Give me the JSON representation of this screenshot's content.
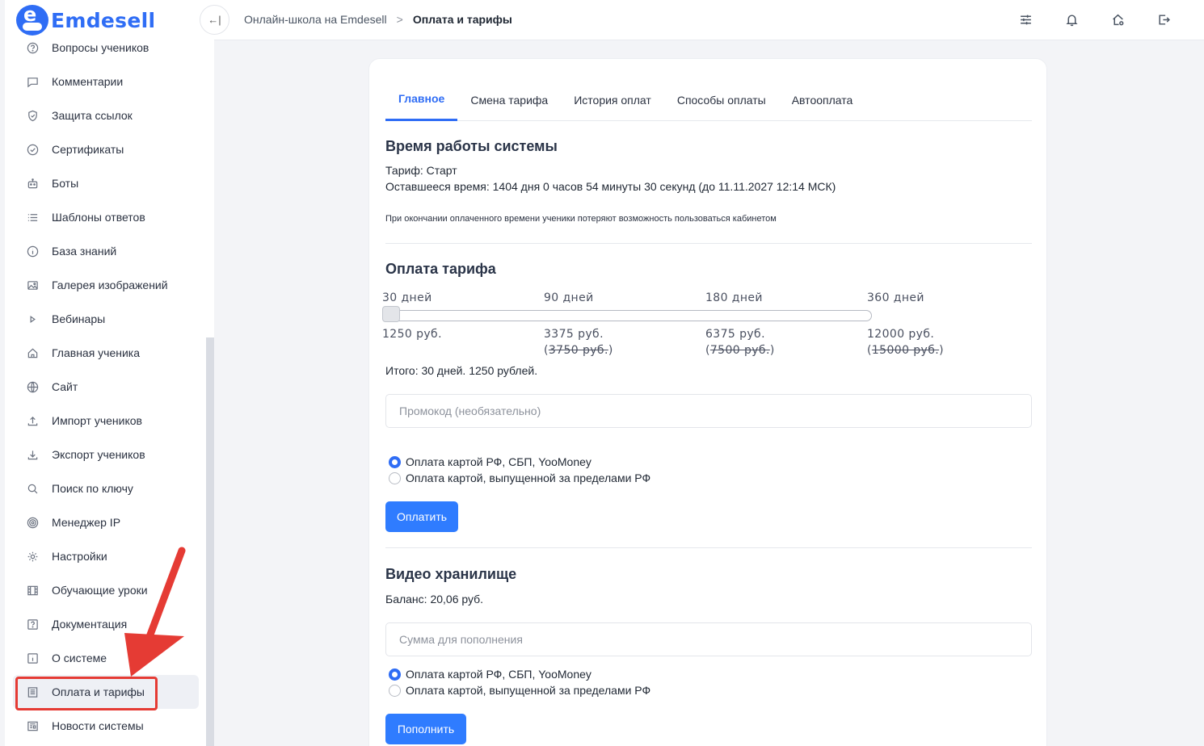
{
  "brand": {
    "name": "Emdesell"
  },
  "sidebar": {
    "items": [
      {
        "label": "Вопросы учеников",
        "icon": "question-circle-icon"
      },
      {
        "label": "Комментарии",
        "icon": "comment-icon"
      },
      {
        "label": "Защита ссылок",
        "icon": "shield-icon"
      },
      {
        "label": "Сертификаты",
        "icon": "check-circle-icon"
      },
      {
        "label": "Боты",
        "icon": "robot-icon"
      },
      {
        "label": "Шаблоны ответов",
        "icon": "list-icon"
      },
      {
        "label": "База знаний",
        "icon": "info-circle-icon"
      },
      {
        "label": "Галерея изображений",
        "icon": "image-icon"
      },
      {
        "label": "Вебинары",
        "icon": "play-icon"
      },
      {
        "label": "Главная ученика",
        "icon": "home-icon"
      },
      {
        "label": "Сайт",
        "icon": "globe-icon"
      },
      {
        "label": "Импорт учеников",
        "icon": "upload-icon"
      },
      {
        "label": "Экспорт учеников",
        "icon": "download-icon"
      },
      {
        "label": "Поиск по ключу",
        "icon": "search-icon"
      },
      {
        "label": "Менеджер IP",
        "icon": "target-icon"
      },
      {
        "label": "Настройки",
        "icon": "gear-icon"
      },
      {
        "label": "Обучающие уроки",
        "icon": "film-icon"
      },
      {
        "label": "Документация",
        "icon": "question-square-icon"
      },
      {
        "label": "О системе",
        "icon": "info-square-icon"
      },
      {
        "label": "Оплата и тарифы",
        "icon": "receipt-icon",
        "active": true
      },
      {
        "label": "Новости системы",
        "icon": "newspaper-icon"
      }
    ]
  },
  "topbar": {
    "breadcrumb_1": "Онлайн-школа на Emdesell",
    "breadcrumb_sep": ">",
    "breadcrumb_2": "Оплата и тарифы",
    "collapse_icon": "collapse-left-icon",
    "icons": [
      "sliders-icon",
      "bell-icon",
      "home-gear-icon",
      "logout-icon"
    ]
  },
  "tabs": [
    "Главное",
    "Смена тарифа",
    "История оплат",
    "Способы оплаты",
    "Автооплата"
  ],
  "system_time": {
    "title": "Время работы системы",
    "tariff": "Тариф: Старт",
    "remaining": "Оставшееся время: 1404 дня 0 часов 54 минуты 30 секунд (до 11.11.2027 12:14 МСК)",
    "note": "При окончании оплаченного времени ученики потеряют возможность пользоваться кабинетом"
  },
  "tariff_payment": {
    "title": "Оплата тарифа",
    "slider_value_index": 0,
    "tiers": [
      {
        "days": "30 дней",
        "price": "1250 руб.",
        "old_price": ""
      },
      {
        "days": "90 дней",
        "price": "3375 руб.",
        "old_price": "3750 руб."
      },
      {
        "days": "180 дней",
        "price": "6375 руб.",
        "old_price": "7500 руб."
      },
      {
        "days": "360 дней",
        "price": "12000 руб.",
        "old_price": "15000 руб."
      }
    ],
    "total": "Итого: 30 дней. 1250 рублей.",
    "promo_placeholder": "Промокод (необязательно)",
    "payment_methods": [
      "Оплата картой РФ, СБП, YooMoney",
      "Оплата картой, выпущенной за пределами РФ"
    ],
    "selected_method": 0,
    "pay_button": "Оплатить"
  },
  "video_storage": {
    "title": "Видео хранилище",
    "balance": "Баланс: 20,06 руб.",
    "amount_placeholder": "Сумма для пополнения",
    "payment_methods": [
      "Оплата картой РФ, СБП, YooMoney",
      "Оплата картой, выпущенной за пределами РФ"
    ],
    "selected_method": 0,
    "topup_button": "Пополнить"
  },
  "colors": {
    "accent": "#2f6df5",
    "button": "#2f7cff",
    "annotation": "#e53b34"
  }
}
